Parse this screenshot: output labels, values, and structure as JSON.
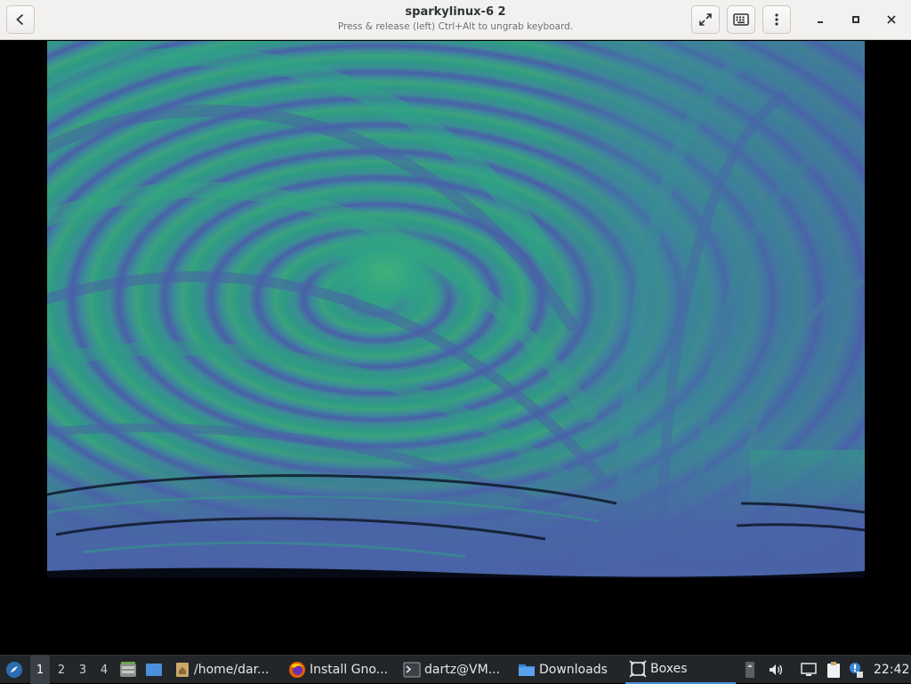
{
  "window": {
    "title": "sparkylinux-6 2",
    "subtitle": "Press & release (left) Ctrl+Alt to ungrab keyboard.",
    "buttons": {
      "back": "go-back-icon",
      "fullscreen": "fullscreen-icon",
      "keyboard": "keyboard-icon",
      "menu": "kebab-menu-icon",
      "minimize": "minimize-icon",
      "maximize": "maximize-icon",
      "close": "close-icon"
    }
  },
  "guest_display": {
    "content": "fractal-wallpaper",
    "colors": {
      "blue": "#4a64a6",
      "green": "#2fa37f",
      "dark": "#000000"
    }
  },
  "taskbar": {
    "menu_icon": "sparky-menu-icon",
    "workspaces": [
      "1",
      "2",
      "3",
      "4"
    ],
    "active_workspace": "1",
    "launchers": [
      "file-manager-launcher-icon",
      "show-desktop-icon"
    ],
    "tasks": [
      {
        "label": "/home/dar...",
        "icon": "folder-home-icon"
      },
      {
        "label": "Install Gno...",
        "icon": "firefox-icon"
      },
      {
        "label": "dartz@VM...",
        "icon": "terminal-icon"
      },
      {
        "label": "Downloads",
        "icon": "folder-icon"
      },
      {
        "label": "Boxes",
        "icon": "boxes-icon",
        "active": true
      }
    ],
    "tray": [
      "scroll-indicator-icon",
      "volume-icon",
      "network-icon",
      "clipboard-icon",
      "update-notifier-icon"
    ],
    "clock": "22:42"
  }
}
